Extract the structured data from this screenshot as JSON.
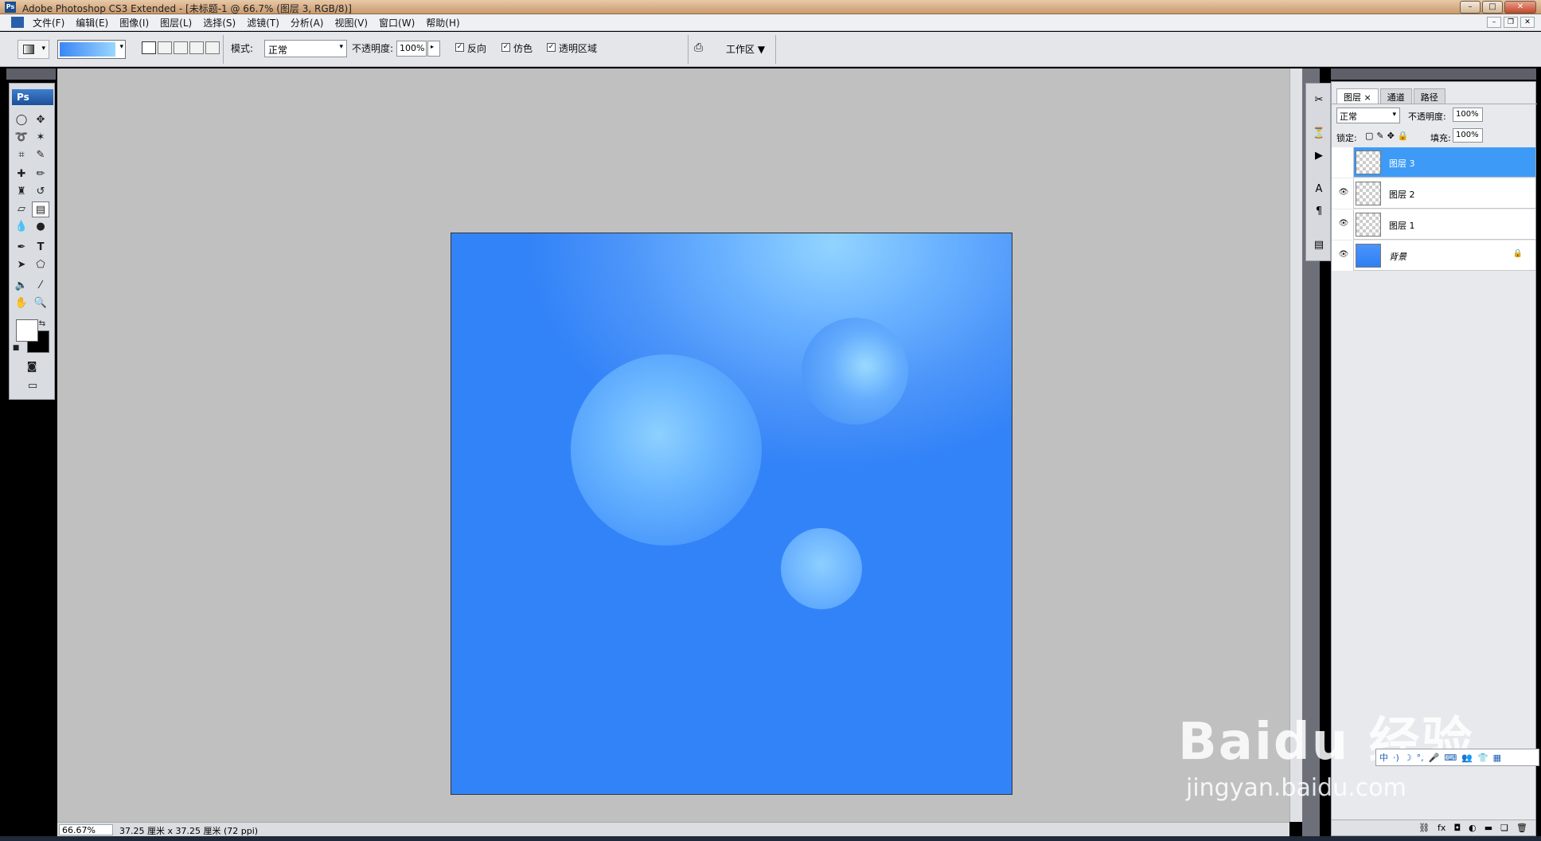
{
  "window": {
    "title": "Adobe Photoshop CS3 Extended - [未标题-1 @ 66.7% (图层 3, RGB/8)]",
    "buttons": [
      "–",
      "□",
      "✕"
    ]
  },
  "menu": [
    "文件(F)",
    "编辑(E)",
    "图像(I)",
    "图层(L)",
    "选择(S)",
    "滤镜(T)",
    "分析(A)",
    "视图(V)",
    "窗口(W)",
    "帮助(H)"
  ],
  "mdi_buttons": [
    "–",
    "❐",
    "✕"
  ],
  "options": {
    "mode_label": "模式:",
    "mode_value": "正常",
    "opacity_label": "不透明度:",
    "opacity_value": "100%",
    "reverse_label": "反向",
    "dither_label": "仿色",
    "transparency_label": "透明区域",
    "workspace_label": "工作区 ▼"
  },
  "toolbox": {
    "header": "Ps"
  },
  "status": {
    "zoom": "66.67%",
    "docinfo": "37.25 厘米 x 37.25 厘米 (72 ppi)"
  },
  "layers_panel": {
    "tabs": [
      "图层 ×",
      "通道",
      "路径"
    ],
    "blend_mode": "正常",
    "opacity_label": "不透明度:",
    "opacity_value": "100%",
    "lock_label": "锁定:",
    "fill_label": "填充:",
    "fill_value": "100%",
    "layers": [
      {
        "name": "图层 3",
        "selected": true
      },
      {
        "name": "图层 2",
        "selected": false
      },
      {
        "name": "图层 1",
        "selected": false
      },
      {
        "name": "背景",
        "selected": false,
        "locked": true
      }
    ]
  },
  "watermark": {
    "line1": "Baidu 经验",
    "line2": "jingyan.baidu.com"
  },
  "ime": [
    "中",
    "·)",
    "☽",
    "°,",
    "🎤",
    "⌨",
    "👥",
    "👕",
    "▦"
  ],
  "colors": {
    "canvas_base": "#3383f8",
    "canvas_highlight": "#92d4ff",
    "layer_selected": "#3d9bf7"
  }
}
